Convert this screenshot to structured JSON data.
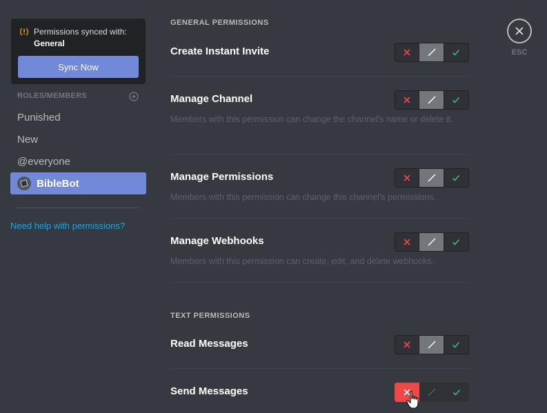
{
  "sync": {
    "line1": "Permissions synced with:",
    "line2": "General",
    "button": "Sync Now"
  },
  "roles": {
    "header": "ROLES/MEMBERS",
    "items": [
      {
        "label": "Punished"
      },
      {
        "label": "New"
      },
      {
        "label": "@everyone"
      },
      {
        "label": "BibleBot"
      }
    ],
    "selected": "BibleBot"
  },
  "help": "Need help with permissions?",
  "close": {
    "label": "ESC"
  },
  "sections": {
    "general": {
      "title": "GENERAL PERMISSIONS",
      "permissions": [
        {
          "name": "Create Instant Invite",
          "desc": "",
          "state": "neutral"
        },
        {
          "name": "Manage Channel",
          "desc": "Members with this permission can change the channel's name or delete it.",
          "state": "neutral"
        },
        {
          "name": "Manage Permissions",
          "desc": "Members with this permission can change this channel's permissions.",
          "state": "neutral"
        },
        {
          "name": "Manage Webhooks",
          "desc": "Members with this permission can create, edit, and delete webhooks.",
          "state": "neutral"
        }
      ]
    },
    "text": {
      "title": "TEXT PERMISSIONS",
      "permissions": [
        {
          "name": "Read Messages",
          "desc": "",
          "state": "neutral"
        },
        {
          "name": "Send Messages",
          "desc": "",
          "state": "deny"
        }
      ]
    }
  },
  "colors": {
    "background": "#36393f",
    "accent": "#7289da",
    "deny": "#f04747",
    "allow": "#43b581",
    "link": "#00b0f4"
  },
  "icons": {
    "sync": "sync-warning-icon",
    "add_role": "plus-circle-icon",
    "close": "close-icon",
    "deny": "x-icon",
    "neutral": "slash-icon",
    "allow": "check-icon"
  }
}
